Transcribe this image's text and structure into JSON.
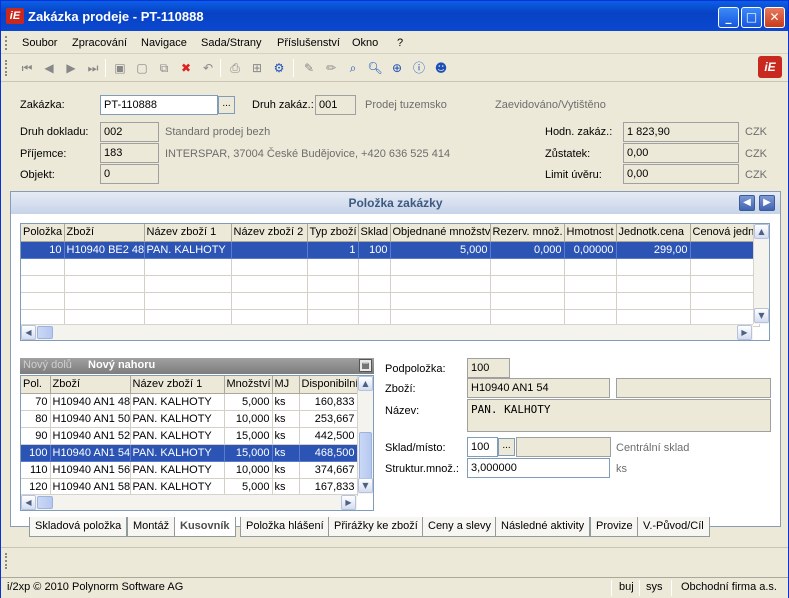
{
  "window": {
    "title": "Zakázka prodeje - PT-110888",
    "logo": "iE"
  },
  "menu": [
    "Soubor",
    "Zpracování",
    "Navigace",
    "Sada/Strany",
    "Příslušenství",
    "Okno",
    "?"
  ],
  "toolbar_icons": [
    "first-icon",
    "prev-icon",
    "next-icon",
    "last-icon",
    "save-icon",
    "new-icon",
    "copy-icon",
    "delete-icon",
    "undo-icon",
    "print-icon",
    "tree-icon",
    "settings-icon",
    "edit-icon",
    "edit2-icon",
    "search-icon",
    "zoom-icon",
    "zoom2-icon",
    "info-icon",
    "user-icon"
  ],
  "header": {
    "zakazka_label": "Zakázka:",
    "zakazka_value": "PT-110888",
    "druh_zakaz_label": "Druh zakáz.:",
    "druh_zakaz_value": "001",
    "druh_zakaz_text": "Prodej tuzemsko",
    "status_text": "Zaevidováno/Vytištěno",
    "druh_dokladu_label": "Druh dokladu:",
    "druh_dokladu_value": "002",
    "druh_dokladu_text": "Standard prodej bezh",
    "prijemce_label": "Příjemce:",
    "prijemce_value": "183",
    "prijemce_text": "INTERSPAR, 37004 České Budějovice, +420 636 525 414",
    "objekt_label": "Objekt:",
    "objekt_value": "0",
    "hodn_label": "Hodn. zakáz.:",
    "hodn_value": "1 823,90",
    "zustatek_label": "Zůstatek:",
    "zustatek_value": "0,00",
    "limit_label": "Limit úvěru:",
    "limit_value": "0,00",
    "currency": "CZK"
  },
  "panel": {
    "title": "Položka zakázky"
  },
  "main_table": {
    "columns": [
      "Položka",
      "Zboží",
      "Název zboží 1",
      "Název zboží 2",
      "Typ zboží",
      "Sklad",
      "Objednané množství",
      "Rezerv. množ.",
      "Hmotnost",
      "Jednotk.cena",
      "Cenová jedno"
    ],
    "rows": [
      {
        "polozka": "10",
        "zbozi": "H10940 BE2 48",
        "nazev1": "PAN. KALHOTY",
        "nazev2": "",
        "typ": "1",
        "sklad": "100",
        "obj": "5,000",
        "rez": "0,000",
        "hm": "0,00000",
        "cena": "299,00",
        "cj": ""
      }
    ]
  },
  "subtabs": {
    "tab1": "Nový dolů",
    "tab2": "Nový nahoru"
  },
  "sub_table": {
    "columns": [
      "Pol.",
      "Zboží",
      "Název zboží 1",
      "Množství",
      "MJ",
      "Disponibilní"
    ],
    "rows": [
      {
        "pol": "70",
        "zbozi": "H10940 AN1 48",
        "nazev": "PAN. KALHOTY",
        "mn": "5,000",
        "mj": "ks",
        "disp": "160,833"
      },
      {
        "pol": "80",
        "zbozi": "H10940 AN1 50",
        "nazev": "PAN. KALHOTY",
        "mn": "10,000",
        "mj": "ks",
        "disp": "253,667"
      },
      {
        "pol": "90",
        "zbozi": "H10940 AN1 52",
        "nazev": "PAN. KALHOTY",
        "mn": "15,000",
        "mj": "ks",
        "disp": "442,500"
      },
      {
        "pol": "100",
        "zbozi": "H10940 AN1 54",
        "nazev": "PAN. KALHOTY",
        "mn": "15,000",
        "mj": "ks",
        "disp": "468,500"
      },
      {
        "pol": "110",
        "zbozi": "H10940 AN1 56",
        "nazev": "PAN. KALHOTY",
        "mn": "10,000",
        "mj": "ks",
        "disp": "374,667"
      },
      {
        "pol": "120",
        "zbozi": "H10940 AN1 58",
        "nazev": "PAN. KALHOTY",
        "mn": "5,000",
        "mj": "ks",
        "disp": "167,833"
      }
    ],
    "selected_index": 3
  },
  "detail": {
    "podpolozka_label": "Podpoložka:",
    "podpolozka_value": "100",
    "zbozi_label": "Zboží:",
    "zbozi_value": "H10940 AN1 54",
    "nazev_label": "Název:",
    "nazev_value": "PAN. KALHOTY",
    "sklad_label": "Sklad/místo:",
    "sklad_value": "100",
    "sklad_text": "Centrální sklad",
    "struktur_label": "Struktur.množ.:",
    "struktur_value": "3,000000",
    "unit": "ks"
  },
  "tabs": [
    "Skladová položka",
    "Montáž",
    "Kusovník",
    "Položka hlášení",
    "Přirážky ke zboží",
    "Ceny a slevy",
    "Následné aktivity",
    "Provize",
    "V.-Původ/Cíl"
  ],
  "active_tab": "Kusovník",
  "status": {
    "copyright": "i/2xp © 2010 Polynorm Software AG",
    "user": "buj",
    "system": "sys",
    "company": "Obchodní firma a.s."
  }
}
